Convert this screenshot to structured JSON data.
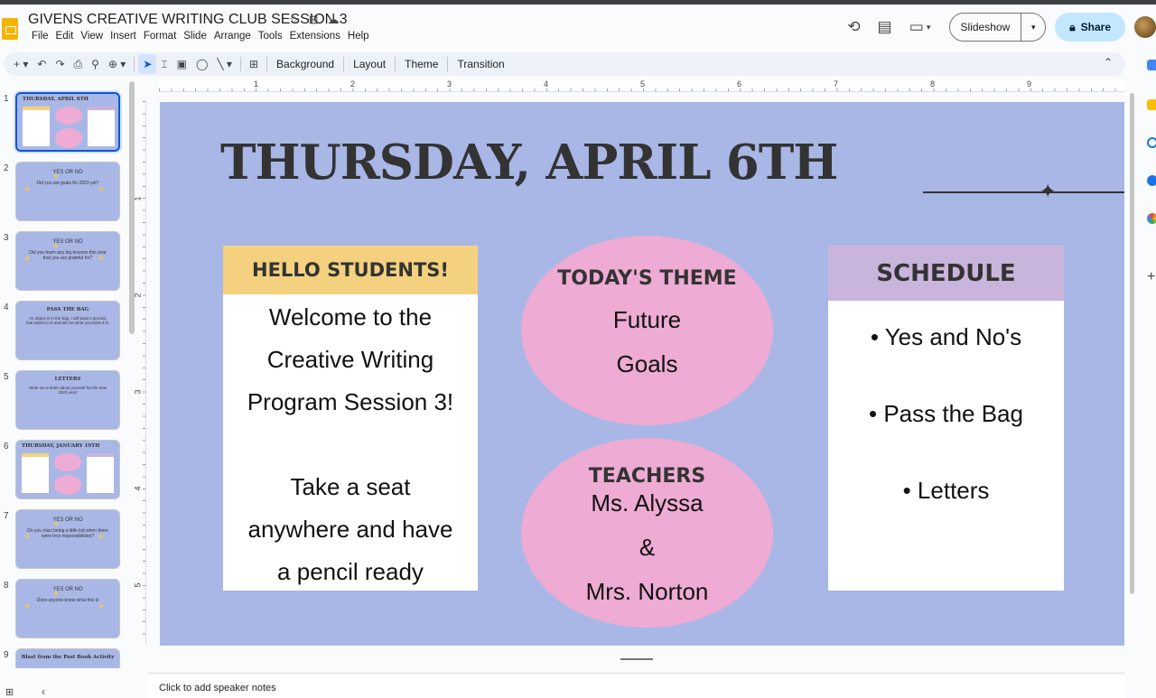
{
  "app": {
    "title": "GIVENS CREATIVE WRITING CLUB SESSION 3",
    "menu": [
      "File",
      "Edit",
      "View",
      "Insert",
      "Format",
      "Slide",
      "Arrange",
      "Tools",
      "Extensions",
      "Help"
    ],
    "slideshow_label": "Slideshow",
    "share_label": "Share"
  },
  "toolbar": {
    "background_label": "Background",
    "layout_label": "Layout",
    "theme_label": "Theme",
    "transition_label": "Transition"
  },
  "ruler": {
    "top_numbers": [
      "1",
      "2",
      "3",
      "4",
      "5",
      "6",
      "7",
      "8",
      "9"
    ],
    "left_numbers": [
      "1",
      "2",
      "3",
      "4",
      "5"
    ]
  },
  "filmstrip": [
    {
      "num": "1",
      "title": "THURSDAY, APRIL 6TH",
      "kind": "agenda",
      "active": true
    },
    {
      "num": "2",
      "title": "YES OR NO",
      "question": "Did you set goals for 2023 yet?",
      "kind": "yesno"
    },
    {
      "num": "3",
      "title": "YES OR NO",
      "question": "Did you learn any big lessons this year that you are grateful for?",
      "kind": "yesno"
    },
    {
      "num": "4",
      "title": "PASS THE BAG",
      "question": "An object is in the bag. I will pass it around, feel what's in it and tell me what you think it is.",
      "kind": "text"
    },
    {
      "num": "5",
      "title": "LETTERS",
      "question": "Write me a letter about yourself for the new 2023 year!",
      "kind": "text"
    },
    {
      "num": "6",
      "title": "THURSDAY, JANUARY 19TH",
      "kind": "agenda"
    },
    {
      "num": "7",
      "title": "YES OR NO",
      "question": "Do you miss being a little kid when there were less responsibilities?",
      "kind": "yesno"
    },
    {
      "num": "8",
      "title": "YES OR NO",
      "question": "Does anyone know what this is",
      "kind": "yesno"
    },
    {
      "num": "9",
      "title": "Blast from the Past Book Activity",
      "kind": "text"
    }
  ],
  "slide": {
    "title": "THURSDAY, APRIL 6TH",
    "hello": {
      "header": "HELLO STUDENTS!",
      "lines": [
        "Welcome to the",
        "Creative Writing",
        "Program Session 3!",
        "",
        "Take a seat",
        "anywhere and have",
        "a pencil ready"
      ]
    },
    "theme": {
      "header": "TODAY'S THEME",
      "line1": "Future",
      "line2": "Goals"
    },
    "teachers": {
      "header": "TEACHERS",
      "line1": "Ms. Alyssa",
      "line2": "&",
      "line3": "Mrs. Norton"
    },
    "schedule": {
      "header": "SCHEDULE",
      "items": [
        "• Yes and No's",
        "• Pass the Bag",
        "• Letters"
      ]
    }
  },
  "notes": {
    "placeholder": "Click to add speaker notes"
  },
  "colors": {
    "slide_bg": "#a9b7e6",
    "hello_header": "#f3d17e",
    "schedule_header": "#c9b4dc",
    "oval": "#eeabd4",
    "share_bg": "#c2e7ff"
  }
}
